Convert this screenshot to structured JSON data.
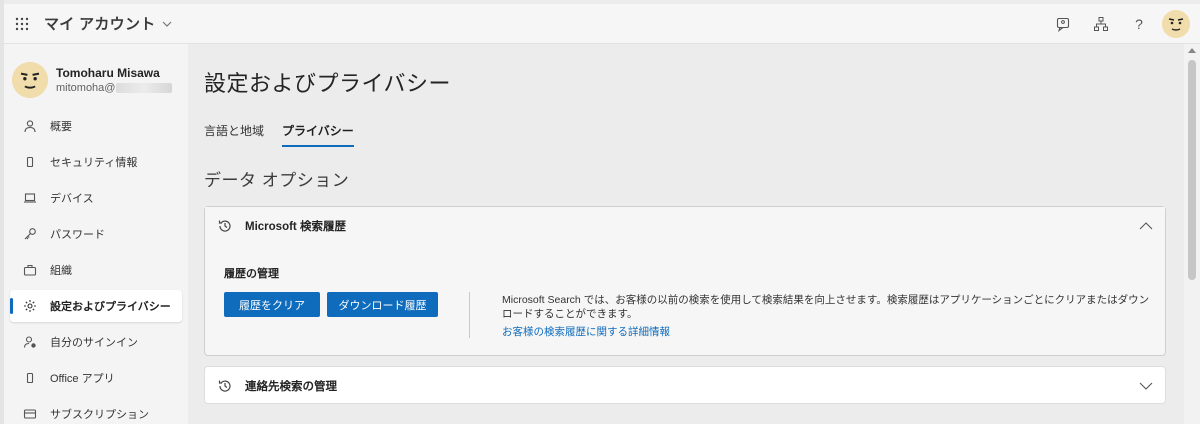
{
  "topbar": {
    "app_title": "マイ アカウント",
    "icons": [
      "waffle-icon",
      "feedback-icon",
      "org-icon",
      "help-icon",
      "avatar"
    ],
    "help_glyph": "?"
  },
  "profile": {
    "name": "Tomoharu Misawa",
    "email": "mitomoha@"
  },
  "sidebar": {
    "items": [
      {
        "label": "概要",
        "icon": "person-icon"
      },
      {
        "label": "セキュリティ情報",
        "icon": "phone-icon"
      },
      {
        "label": "デバイス",
        "icon": "laptop-icon"
      },
      {
        "label": "パスワード",
        "icon": "key-icon"
      },
      {
        "label": "組織",
        "icon": "briefcase-icon"
      },
      {
        "label": "設定およびプライバシー",
        "icon": "gear-icon",
        "active": true
      },
      {
        "label": "自分のサインイン",
        "icon": "person-signin-icon"
      },
      {
        "label": "Office アプリ",
        "icon": "phone-icon"
      },
      {
        "label": "サブスクリプション",
        "icon": "card-icon"
      }
    ]
  },
  "main": {
    "title": "設定およびプライバシー",
    "tabs": [
      {
        "label": "言語と地域",
        "active": false
      },
      {
        "label": "プライバシー",
        "active": true
      }
    ],
    "section_title": "データ オプション",
    "cards": [
      {
        "title": "Microsoft 検索履歴",
        "expanded": true,
        "management_label": "履歴の管理",
        "buttons": [
          "履歴をクリア",
          "ダウンロード履歴"
        ],
        "description": "Microsoft Search では、お客様の以前の検索を使用して検索結果を向上させます。検索履歴はアプリケーションごとにクリアまたはダウンロードすることができます。",
        "link": "お客様の検索履歴に関する詳細情報"
      },
      {
        "title": "連絡先検索の管理",
        "expanded": false
      }
    ]
  },
  "colors": {
    "accent": "#0f6cbd",
    "background": "#ececec"
  }
}
